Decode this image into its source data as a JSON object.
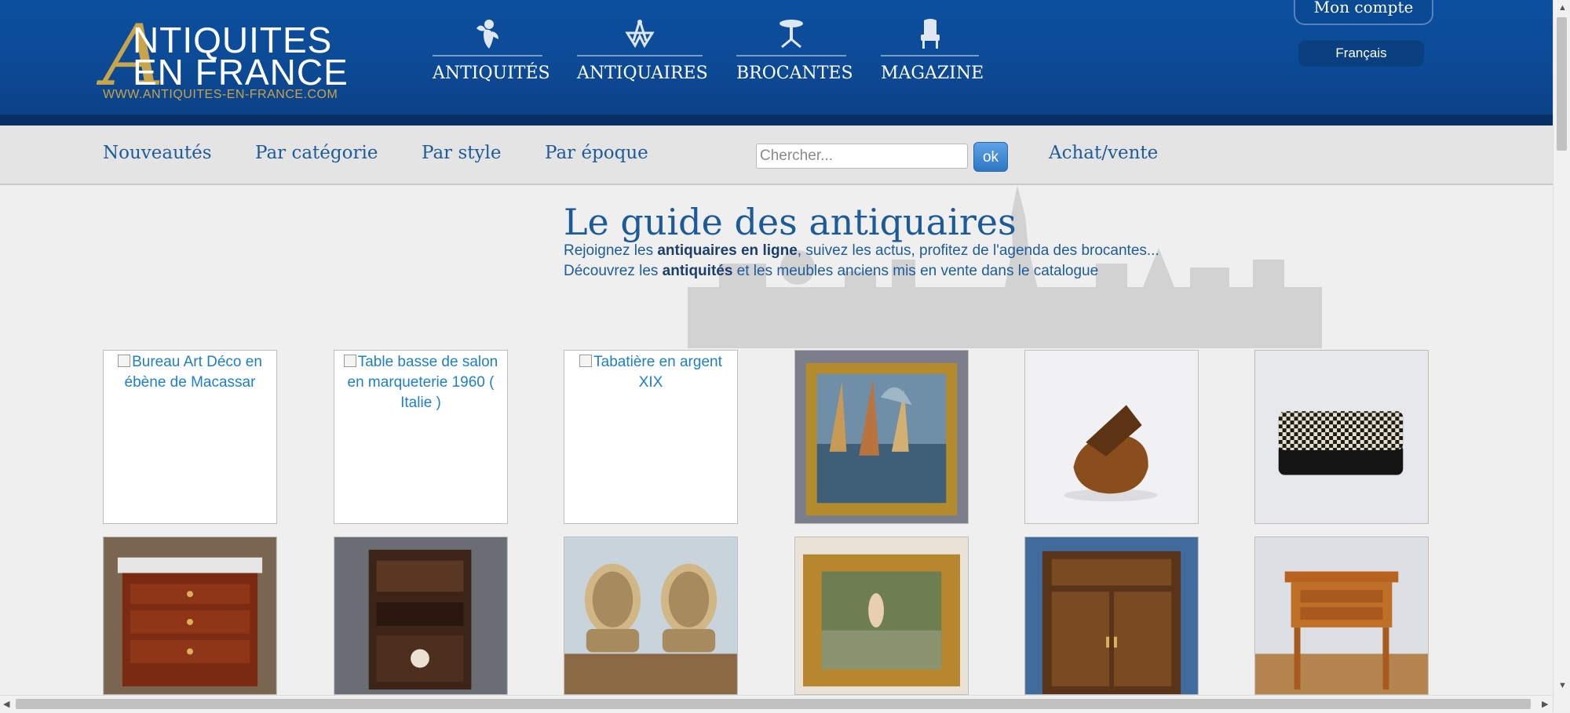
{
  "header": {
    "logo_initial": "A",
    "logo_line1": "NTIQUITES",
    "logo_line2": "EN FRANCE",
    "logo_url": "WWW.ANTIQUITES-EN-FRANCE.COM",
    "nav": [
      {
        "label": "ANTIQUITÉS",
        "icon": "cherub-icon"
      },
      {
        "label": "ANTIQUAIRES",
        "icon": "compass-icon"
      },
      {
        "label": "BROCANTES",
        "icon": "table-icon"
      },
      {
        "label": "MAGAZINE",
        "icon": "armchair-icon"
      }
    ],
    "account_label": "Mon compte",
    "language": "Français"
  },
  "subnav": {
    "items": [
      "Nouveautés",
      "Par catégorie",
      "Par style",
      "Par époque"
    ],
    "search_placeholder": "Chercher...",
    "search_button": "ok",
    "buy_sell": "Achat/vente"
  },
  "intro": {
    "title": "Le guide des antiquaires",
    "line1_pre": "Rejoignez les ",
    "line1_bold": "antiquaires en ligne",
    "line1_post": ", suivez les actus, profitez de l'agenda des brocantes...",
    "line2_pre": "Découvrez les ",
    "line2_bold": "antiquités",
    "line2_post": " et les meubles anciens mis en vente dans le catalogue"
  },
  "products": {
    "row1": [
      {
        "alt": "Bureau Art Déco en ébène de Macassar",
        "broken": true
      },
      {
        "alt": "Table basse de salon en marqueterie 1960 ( Italie )",
        "broken": true
      },
      {
        "alt": "Tabatière en argent XIX",
        "broken": true
      },
      {
        "image": "harbor-painting",
        "broken": false
      },
      {
        "image": "tortoiseshell-box",
        "broken": false
      },
      {
        "image": "checkered-box",
        "broken": false
      }
    ],
    "row2": [
      {
        "image": "mahogany-commode"
      },
      {
        "image": "asian-cabinet"
      },
      {
        "image": "pair-of-armchairs"
      },
      {
        "image": "nude-painting"
      },
      {
        "image": "carved-cabinet"
      },
      {
        "image": "side-table"
      }
    ]
  },
  "colors": {
    "header_blue": "#0a4f9e",
    "gold": "#c8a44a",
    "link_blue": "#1e5c99"
  }
}
